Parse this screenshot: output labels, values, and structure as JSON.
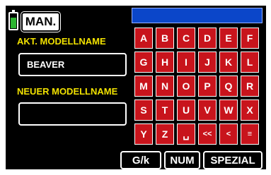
{
  "mode_button": "MAN.",
  "labels": {
    "current_model": "AKT. MODELLNAME",
    "new_model": "NEUER MODELLNAME"
  },
  "fields": {
    "current_model_value": "BEAVER",
    "new_model_value": ""
  },
  "keyboard_rows": [
    [
      "A",
      "B",
      "C",
      "D",
      "E",
      "F"
    ],
    [
      "G",
      "H",
      "I",
      "J",
      "K",
      "L"
    ],
    [
      "M",
      "N",
      "O",
      "P",
      "Q",
      "R"
    ],
    [
      "S",
      "T",
      "U",
      "V",
      "W",
      "X"
    ],
    [
      "Y",
      "Z",
      "␣",
      "<<",
      "<",
      "≡"
    ]
  ],
  "bottom_buttons": {
    "case": "G/k",
    "num": "NUM",
    "special": "SPEZIAL"
  },
  "colors": {
    "label": "#f2e200",
    "key": "#c8141c",
    "input_bar": "#0b46c9",
    "battery": "#2db531"
  },
  "battery_level": 0.7
}
